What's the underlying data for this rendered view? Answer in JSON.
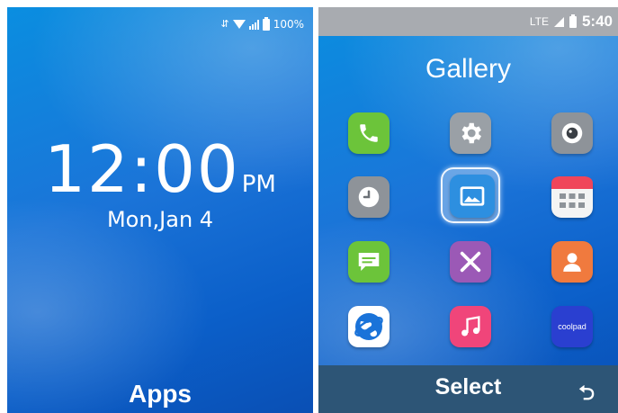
{
  "lock_screen": {
    "status": {
      "battery": "100%"
    },
    "clock": {
      "time": "12:00",
      "ampm": "PM"
    },
    "date": "Mon,Jan 4",
    "softkey_center": "Apps"
  },
  "menu_screen": {
    "status": {
      "network": "LTE",
      "time": "5:40"
    },
    "title": "Gallery",
    "apps": [
      {
        "name": "phone",
        "icon": "phone-icon",
        "color": "#6cc43a"
      },
      {
        "name": "settings",
        "icon": "gear-icon",
        "color": "#9aa0a6"
      },
      {
        "name": "camera",
        "icon": "camera-icon",
        "color": "#8e9399"
      },
      {
        "name": "clock",
        "icon": "clock-icon",
        "color": "#8e9399"
      },
      {
        "name": "gallery",
        "icon": "image-icon",
        "color": "#2d8fe0",
        "selected": true
      },
      {
        "name": "calendar",
        "icon": "calendar-icon",
        "color": "#f0f0f0"
      },
      {
        "name": "messages",
        "icon": "message-icon",
        "color": "#6cc43a"
      },
      {
        "name": "tools",
        "icon": "tools-icon",
        "color": "#9b59b6"
      },
      {
        "name": "contacts",
        "icon": "contact-icon",
        "color": "#f07a3e"
      },
      {
        "name": "browser",
        "icon": "globe-icon",
        "color": "#ffffff"
      },
      {
        "name": "music",
        "icon": "music-icon",
        "color": "#f0457a"
      },
      {
        "name": "coolpad",
        "icon": "coolpad-icon",
        "color": "#2a3fd0",
        "label": "coolpad"
      }
    ],
    "softkeys": {
      "center": "Select",
      "right_icon": "back-icon"
    }
  }
}
